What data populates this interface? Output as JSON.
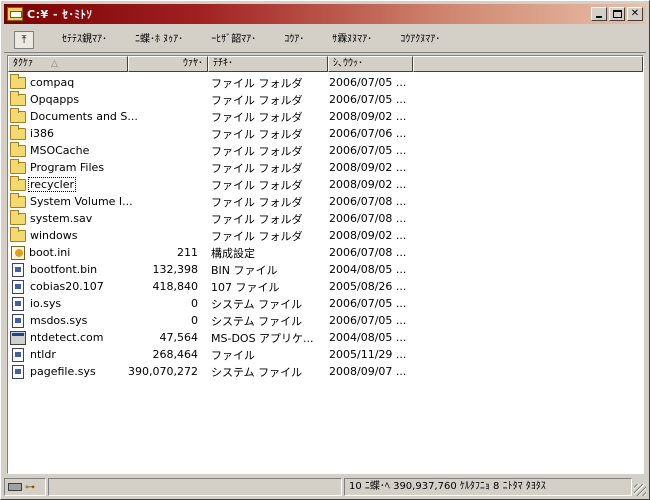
{
  "window": {
    "title": "C:¥ - ｾ･ﾐﾄｿ",
    "buttons": {
      "minimize": "_",
      "maximize": "□",
      "close": "×"
    }
  },
  "toolbar": {
    "up_icon": "folder-up-icon",
    "items": [
      "ｾﾃﾃｽ鋧ﾏｱ･",
      "ﾆ蝶･ﾎ ﾇｩｱ･",
      "ｰﾋｻﾞ韶ﾏｱ･",
      "ｺｳｱ･",
      "ｻ霖ﾇﾇﾏｱ･",
      "ｺｳｱｸﾇﾏｱ･"
    ]
  },
  "columns": {
    "name": "ﾀｸｹｧ",
    "size": "ｳｧﾔ･",
    "type": "ﾃﾁｷ･",
    "date": "ｼ､ｳｳｯ･"
  },
  "files": [
    {
      "name": "compaq",
      "size": "",
      "type": "ファイル フォルダ",
      "date": "2006/07/05 ...",
      "kind": "folder"
    },
    {
      "name": "Opqapps",
      "size": "",
      "type": "ファイル フォルダ",
      "date": "2006/07/05 ...",
      "kind": "folder"
    },
    {
      "name": "Documents and S...",
      "size": "",
      "type": "ファイル フォルダ",
      "date": "2008/09/02 ...",
      "kind": "folder"
    },
    {
      "name": "i386",
      "size": "",
      "type": "ファイル フォルダ",
      "date": "2006/07/06 ...",
      "kind": "folder"
    },
    {
      "name": "MSOCache",
      "size": "",
      "type": "ファイル フォルダ",
      "date": "2006/07/05 ...",
      "kind": "folder"
    },
    {
      "name": "Program Files",
      "size": "",
      "type": "ファイル フォルダ",
      "date": "2008/09/02 ...",
      "kind": "folder"
    },
    {
      "name": "recycler",
      "size": "",
      "type": "ファイル フォルダ",
      "date": "2008/09/02 ...",
      "kind": "folder",
      "focused": true
    },
    {
      "name": "System Volume I...",
      "size": "",
      "type": "ファイル フォルダ",
      "date": "2006/07/08 ...",
      "kind": "folder"
    },
    {
      "name": "system.sav",
      "size": "",
      "type": "ファイル フォルダ",
      "date": "2006/07/08 ...",
      "kind": "folder"
    },
    {
      "name": "windows",
      "size": "",
      "type": "ファイル フォルダ",
      "date": "2008/09/02 ...",
      "kind": "folder"
    },
    {
      "name": "boot.ini",
      "size": "211",
      "type": "構成設定",
      "date": "2006/07/08 ...",
      "kind": "ini"
    },
    {
      "name": "bootfont.bin",
      "size": "132,398",
      "type": "BIN ファイル",
      "date": "2004/08/05 ...",
      "kind": "file"
    },
    {
      "name": "cobias20.107",
      "size": "418,840",
      "type": "107 ファイル",
      "date": "2005/08/26 ...",
      "kind": "file"
    },
    {
      "name": "io.sys",
      "size": "0",
      "type": "システム ファイル",
      "date": "2006/07/05 ...",
      "kind": "file"
    },
    {
      "name": "msdos.sys",
      "size": "0",
      "type": "システム ファイル",
      "date": "2006/07/05 ...",
      "kind": "file"
    },
    {
      "name": "ntdetect.com",
      "size": "47,564",
      "type": "MS-DOS アプリケ...",
      "date": "2004/08/05 ...",
      "kind": "exe"
    },
    {
      "name": "ntldr",
      "size": "268,464",
      "type": "ファイル",
      "date": "2005/11/29 ...",
      "kind": "file"
    },
    {
      "name": "pagefile.sys",
      "size": "390,070,272",
      "type": "システム ファイル",
      "date": "2008/09/07 ...",
      "kind": "file"
    }
  ],
  "statusbar": {
    "summary": "10 ﾆ蝶･ﾍ 390,937,760 ｹﾙﾀﾌﾆｮ 8 ﾆﾄﾀﾏ ﾀﾖﾀｽ"
  }
}
